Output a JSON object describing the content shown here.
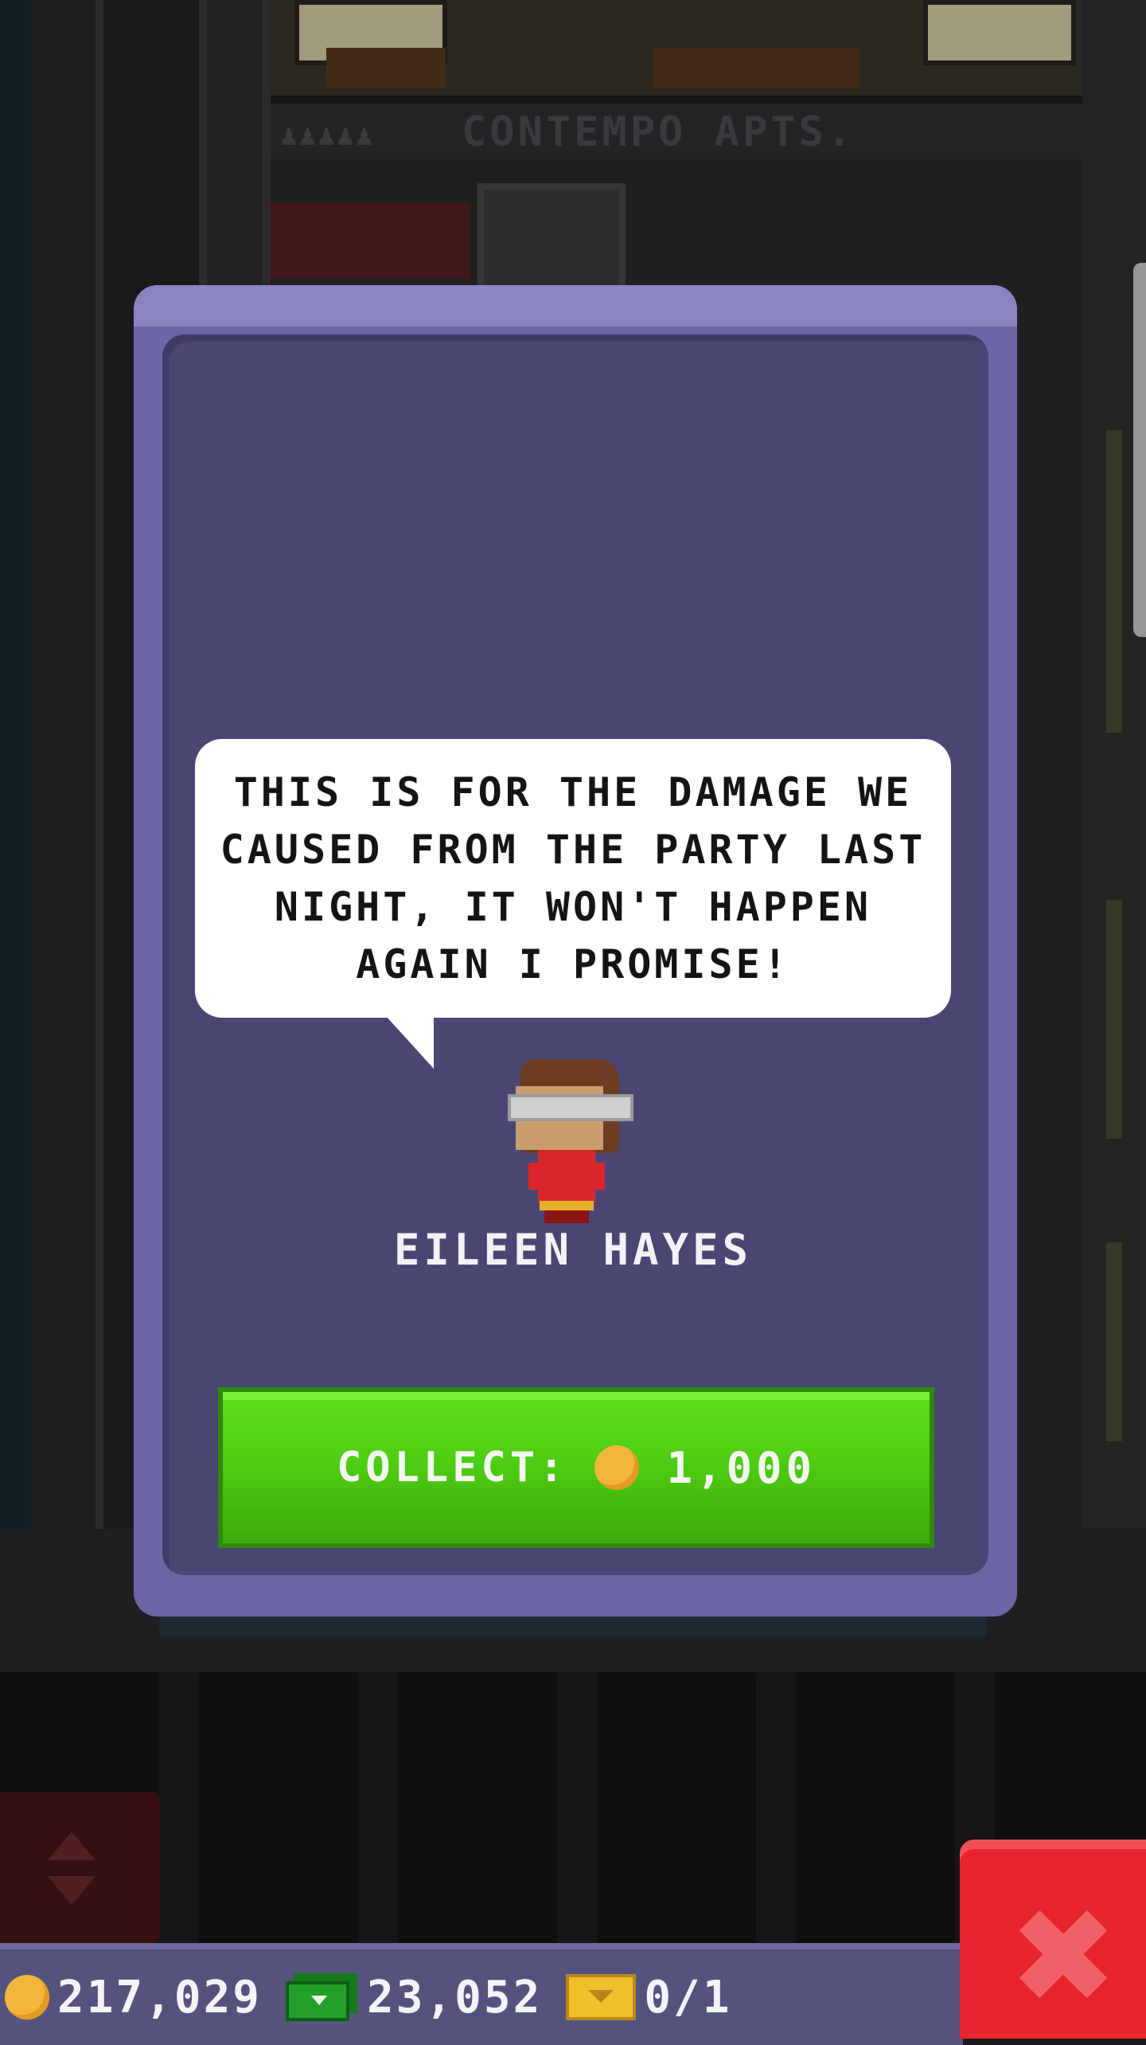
{
  "background": {
    "building_sign": "CONTEMPO APTS."
  },
  "dialog": {
    "message": "THIS IS FOR THE DAMAGE WE CAUSED FROM THE PARTY LAST NIGHT, IT WON'T HAPPEN AGAIN I PROMISE!",
    "character_name": "EILEEN HAYES",
    "collect_label": "COLLECT:",
    "collect_amount": "1,000",
    "collect_icon": "coin-icon"
  },
  "statusbar": {
    "coins": "217,029",
    "bux": "23,052",
    "tickets": "0/1"
  },
  "colors": {
    "modal_outer": "#6c66a4",
    "modal_inner": "#4a4673",
    "collect_button": "#4ecd12",
    "close_button": "#e8252e",
    "coin": "#f4b63a"
  }
}
